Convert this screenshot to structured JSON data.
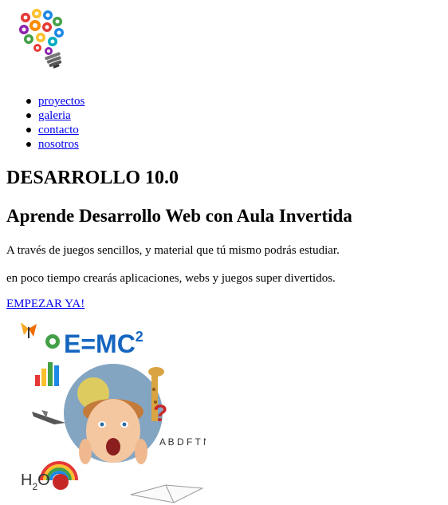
{
  "nav": {
    "items": [
      {
        "label": "proyectos"
      },
      {
        "label": "galeria"
      },
      {
        "label": "contacto"
      },
      {
        "label": "nosotros"
      }
    ]
  },
  "header": {
    "brand": "DESARROLLO 10.0",
    "headline": "Aprende Desarrollo Web con Aula Invertida"
  },
  "main": {
    "paragraph1": "A través de juegos sencillos, y material que tú mismo podrás estudiar.",
    "paragraph2": "en poco tiempo crearás aplicaciones, webs y juegos super divertidos.",
    "cta_label": "EMPEZAR YA!"
  },
  "hero": {
    "formula": "E=MC",
    "formula_exp": "2",
    "h2o": "H",
    "h2o_sub": "2",
    "h2o_o": "O",
    "letters": "A B D F T N"
  },
  "icons": {
    "logo": "gear-lightbulb-logo",
    "hero": "kid-science-collage-image"
  },
  "colors": {
    "link": "#0000ee",
    "text": "#000000",
    "background": "#ffffff"
  }
}
